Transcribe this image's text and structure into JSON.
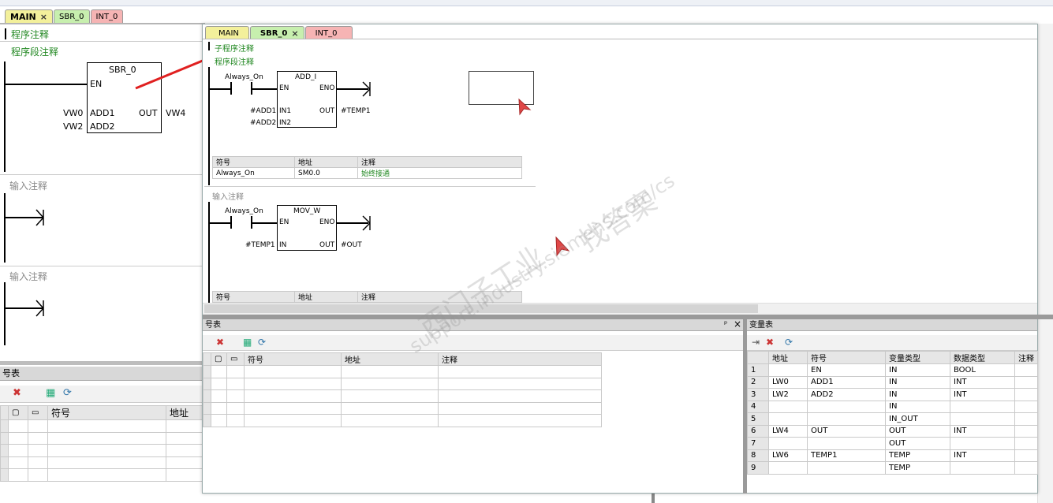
{
  "main_tabs": [
    {
      "label": "MAIN",
      "style": "yel",
      "active": true
    },
    {
      "label": "SBR_0",
      "style": "grn"
    },
    {
      "label": "INT_0",
      "style": "red"
    }
  ],
  "bg": {
    "program_comment": "程序注释",
    "segment_comment": "程序段注释",
    "sbr_name": "SBR_0",
    "en": "EN",
    "add1": "ADD1",
    "add2": "ADD2",
    "out": "OUT",
    "vw0": "VW0",
    "vw2": "VW2",
    "vw4": "VW4",
    "input_comment_1": "输入注释",
    "input_comment_2": "输入注释",
    "symbol_panel_title": "号表",
    "col_symbol": "符号",
    "col_address": "地址"
  },
  "sub_tabs": [
    {
      "label": "MAIN",
      "style": "yel"
    },
    {
      "label": "SBR_0",
      "style": "grn",
      "active": true
    },
    {
      "label": "INT_0",
      "style": "red"
    }
  ],
  "sub": {
    "sub_comment": "子程序注释",
    "segment_comment": "程序段注释",
    "n1": {
      "contact": "Always_On",
      "block": "ADD_I",
      "en": "EN",
      "eno": "ENO",
      "in1": "IN1",
      "in2": "IN2",
      "out": "OUT",
      "p_add1": "#ADD1",
      "p_add2": "#ADD2",
      "p_out": "#TEMP1"
    },
    "symtab1": {
      "headers": [
        "符号",
        "地址",
        "注释"
      ],
      "rows": [
        [
          "Always_On",
          "SM0.0",
          "始终接通"
        ]
      ]
    },
    "input_comment": "输入注释",
    "n2": {
      "contact": "Always_On",
      "block": "MOV_W",
      "en": "EN",
      "eno": "ENO",
      "in": "IN",
      "out": "OUT",
      "p_in": "#TEMP1",
      "p_out": "#OUT"
    },
    "symtab2": {
      "headers": [
        "符号",
        "地址",
        "注释"
      ]
    }
  },
  "symbol_panel": {
    "title": "号表",
    "pin": "ᵖ",
    "close": "×",
    "headers": [
      "符号",
      "地址",
      "注释"
    ]
  },
  "var_panel": {
    "title": "变量表",
    "headers": [
      "地址",
      "符号",
      "变量类型",
      "数据类型",
      "注释"
    ],
    "rows": [
      [
        "1",
        "",
        "EN",
        "IN",
        "BOOL"
      ],
      [
        "2",
        "LW0",
        "ADD1",
        "IN",
        "INT"
      ],
      [
        "3",
        "LW2",
        "ADD2",
        "IN",
        "INT"
      ],
      [
        "4",
        "",
        "",
        "IN",
        ""
      ],
      [
        "5",
        "",
        "",
        "IN_OUT",
        ""
      ],
      [
        "6",
        "LW4",
        "OUT",
        "OUT",
        "INT"
      ],
      [
        "7",
        "",
        "",
        "OUT",
        ""
      ],
      [
        "8",
        "LW6",
        "TEMP1",
        "TEMP",
        "INT"
      ],
      [
        "9",
        "",
        "",
        "TEMP",
        ""
      ]
    ]
  },
  "watermark": {
    "line1": "西门子工业",
    "line2": "找答案",
    "line3": "support.industry.siemens.com/cs"
  },
  "colors": {
    "arrow": "#e02020",
    "green_text": "#228822",
    "cursor": "#e04848"
  }
}
